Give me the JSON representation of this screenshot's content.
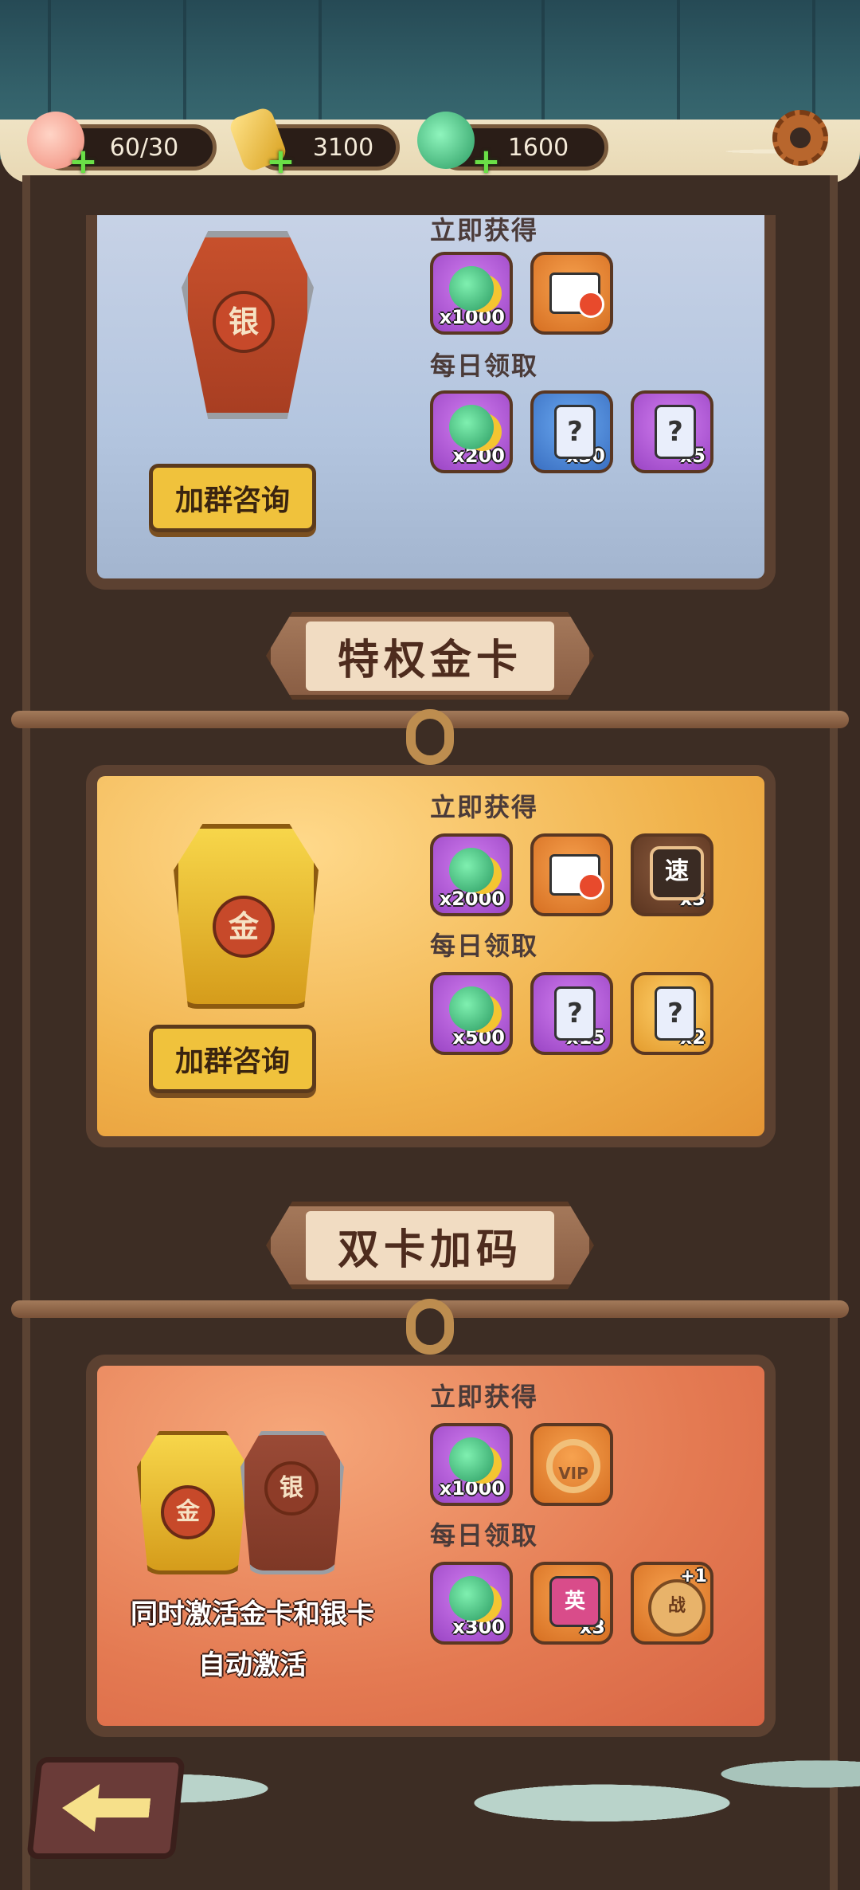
{
  "resources": [
    {
      "name": "peach",
      "value": "60/30"
    },
    {
      "name": "energy",
      "value": "3100"
    },
    {
      "name": "jade",
      "value": "1600"
    }
  ],
  "silver_card": {
    "emblem_char": "银",
    "instant_label": "立即获得",
    "daily_label": "每日领取",
    "consult_label": "加群咨询",
    "instant_rewards": [
      {
        "icon": "jade-icon",
        "count": "x1000"
      },
      {
        "icon": "no-ads-icon",
        "count": ""
      }
    ],
    "daily_rewards": [
      {
        "icon": "jade-icon",
        "count": "x200"
      },
      {
        "icon": "blue-card-icon",
        "count": "x30"
      },
      {
        "icon": "purple-card-icon",
        "count": "x5"
      }
    ]
  },
  "gold_section": {
    "title": "特权金卡"
  },
  "gold_card": {
    "emblem_char": "金",
    "instant_label": "立即获得",
    "daily_label": "每日领取",
    "consult_label": "加群咨询",
    "instant_rewards": [
      {
        "icon": "jade-icon",
        "count": "x2000"
      },
      {
        "icon": "no-ads-icon",
        "count": ""
      },
      {
        "icon": "speed-icon",
        "label": "速",
        "count": "x3"
      }
    ],
    "daily_rewards": [
      {
        "icon": "jade-icon",
        "count": "x500"
      },
      {
        "icon": "purple-card-icon",
        "count": "x15"
      },
      {
        "icon": "orange-card-icon",
        "count": "x2"
      }
    ]
  },
  "double_section": {
    "title": "双卡加码"
  },
  "double_card": {
    "emblem_gold": "金",
    "emblem_silver": "银",
    "instant_label": "立即获得",
    "daily_label": "每日领取",
    "description_line1": "同时激活金卡和银卡",
    "description_line2": "自动激活",
    "instant_rewards": [
      {
        "icon": "jade-icon",
        "count": "x1000"
      },
      {
        "icon": "vip-frame-icon",
        "label": "VIP",
        "count": ""
      }
    ],
    "daily_rewards": [
      {
        "icon": "jade-icon",
        "count": "x300"
      },
      {
        "icon": "hero-card-icon",
        "label": "英",
        "count": "x3"
      },
      {
        "icon": "battle-icon",
        "label": "战",
        "count": "+1"
      }
    ]
  }
}
